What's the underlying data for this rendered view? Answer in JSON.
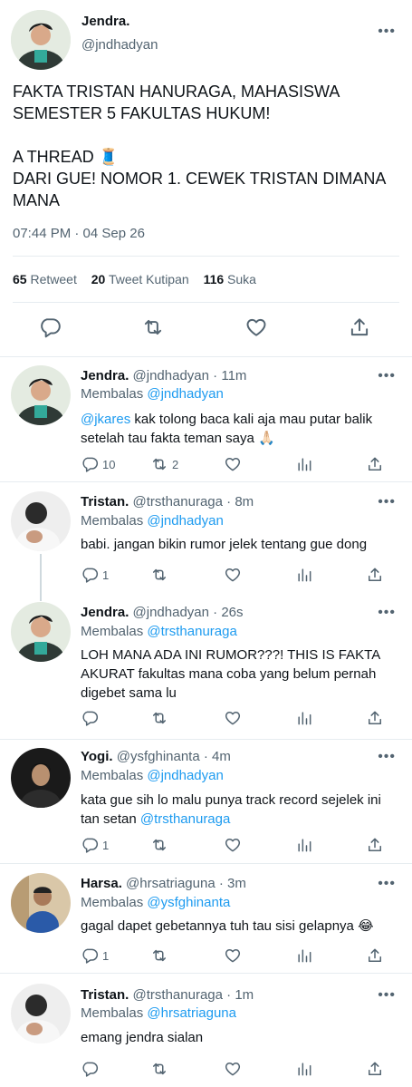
{
  "main_tweet": {
    "name": "Jendra.",
    "handle": "@jndhadyan",
    "text": "FAKTA TRISTAN HANURAGA, MAHASISWA SEMESTER 5 FAKULTAS HUKUM!\n\nA THREAD 🧵\nDARI GUE! NOMOR 1. CEWEK TRISTAN DIMANA MANA",
    "timestamp": "07:44 PM · 04 Sep 26",
    "retweets": "65",
    "retweets_label": "Retweet",
    "quotes": "20",
    "quotes_label": "Tweet Kutipan",
    "likes": "116",
    "likes_label": "Suka"
  },
  "reply_prefix": "Membalas",
  "replies": [
    {
      "name": "Jendra.",
      "handle": "@jndhadyan",
      "time": "· 11m",
      "reply_to": "@jndhadyan",
      "mention": "@jkares",
      "text": " kak tolong baca kali aja mau putar balik setelah tau fakta teman saya 🙏🏻",
      "reply_count": "10",
      "retweet_count": "2"
    },
    {
      "name": "Tristan.",
      "handle": "@trsthanuraga",
      "time": "· 8m",
      "reply_to": "@jndhadyan",
      "text": "babi. jangan bikin rumor jelek tentang gue dong",
      "reply_count": "1"
    },
    {
      "name": "Jendra.",
      "handle": "@jndhadyan",
      "time": "· 26s",
      "reply_to": "@trsthanuraga",
      "text": "LOH MANA ADA INI RUMOR???! THIS IS FAKTA AKURAT fakultas mana coba yang belum pernah digebet sama lu"
    },
    {
      "name": "Yogi.",
      "handle": "@ysfghinanta",
      "time": "· 4m",
      "reply_to": "@jndhadyan",
      "text": "kata gue sih lo malu punya track record sejelek ini tan setan ",
      "mention": "@trsthanuraga",
      "reply_count": "1"
    },
    {
      "name": "Harsa.",
      "handle": "@hrsatriaguna",
      "time": "· 3m",
      "reply_to": "@ysfghinanta",
      "text": "gagal dapet gebetannya tuh tau sisi gelapnya 😂",
      "reply_count": "1"
    },
    {
      "name": "Tristan.",
      "handle": "@trsthanuraga",
      "time": "· 1m",
      "reply_to": "@hrsatriaguna",
      "text": "emang jendra sialan"
    }
  ],
  "icons": {
    "more": "more-horizontal-icon",
    "reply": "reply-icon",
    "retweet": "retweet-icon",
    "like": "heart-icon",
    "analytics": "analytics-icon",
    "share": "share-icon"
  },
  "colors": {
    "accent": "#1d9bf0",
    "secondary": "#536471",
    "divider": "#e6ecf0"
  }
}
